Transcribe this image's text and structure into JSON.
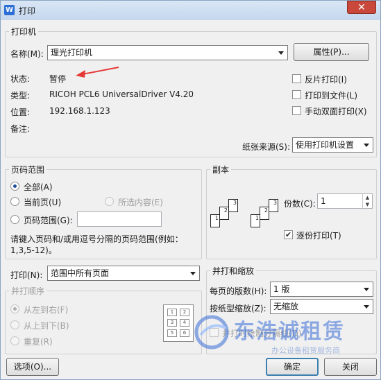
{
  "window": {
    "title": "打印",
    "close_glyph": "✕",
    "icon_text": "W"
  },
  "printer": {
    "group_title": "打印机",
    "name_label": "名称(M):",
    "name_value": "理光打印机",
    "properties_button": "属性(P)...",
    "status_label": "状态:",
    "status_value": "暂停",
    "type_label": "类型:",
    "type_value": "RICOH PCL6 UniversalDriver V4.20",
    "location_label": "位置:",
    "location_value": "192.168.1.123",
    "comment_label": "备注:",
    "options": [
      {
        "label": "反片打印(I)",
        "checked": false
      },
      {
        "label": "打印到文件(L)",
        "checked": false
      },
      {
        "label": "手动双面打印(X)",
        "checked": false
      }
    ],
    "paper_source_label": "纸张来源(S):",
    "paper_source_value": "使用打印机设置"
  },
  "page_range": {
    "group_title": "页码范围",
    "all_label": "全部(A)",
    "current_label": "当前页(U)",
    "selection_label": "所选内容(E)",
    "pages_label": "页码范围(G):",
    "pages_value": "",
    "hint_line1": "请键入页码和/或用逗号分隔的页码范围(例如：",
    "hint_line2": "1,3,5-12)。"
  },
  "copies": {
    "group_title": "副本",
    "count_label": "份数(C):",
    "count_value": "1",
    "collate_label": "逐份打印(T)",
    "collate_checked": true
  },
  "print_what": {
    "label": "打印(N):",
    "value": "范围中所有页面"
  },
  "order": {
    "group_title": "并打顺序",
    "left_to_right": "从左到右(F)",
    "top_to_bottom": "从上到下(B)",
    "repeat": "重复(R)"
  },
  "zoom": {
    "group_title": "并打和缩放",
    "pages_per_sheet_label": "每页的版数(H):",
    "pages_per_sheet_value": "1 版",
    "scale_label": "按纸型缩放(Z):",
    "scale_value": "无缩放",
    "draw_borders_label": "并打时绘制分隔线(D)"
  },
  "footer": {
    "options_button": "选项(O)...",
    "ok_button": "确定",
    "close_button": "关闭"
  },
  "watermark": {
    "text": "东浩诚租赁",
    "subtext": "办公设备租赁服务商"
  },
  "colors": {
    "accent": "#2b6ed6",
    "annotation": "#e53935",
    "close": "#c9483b"
  }
}
